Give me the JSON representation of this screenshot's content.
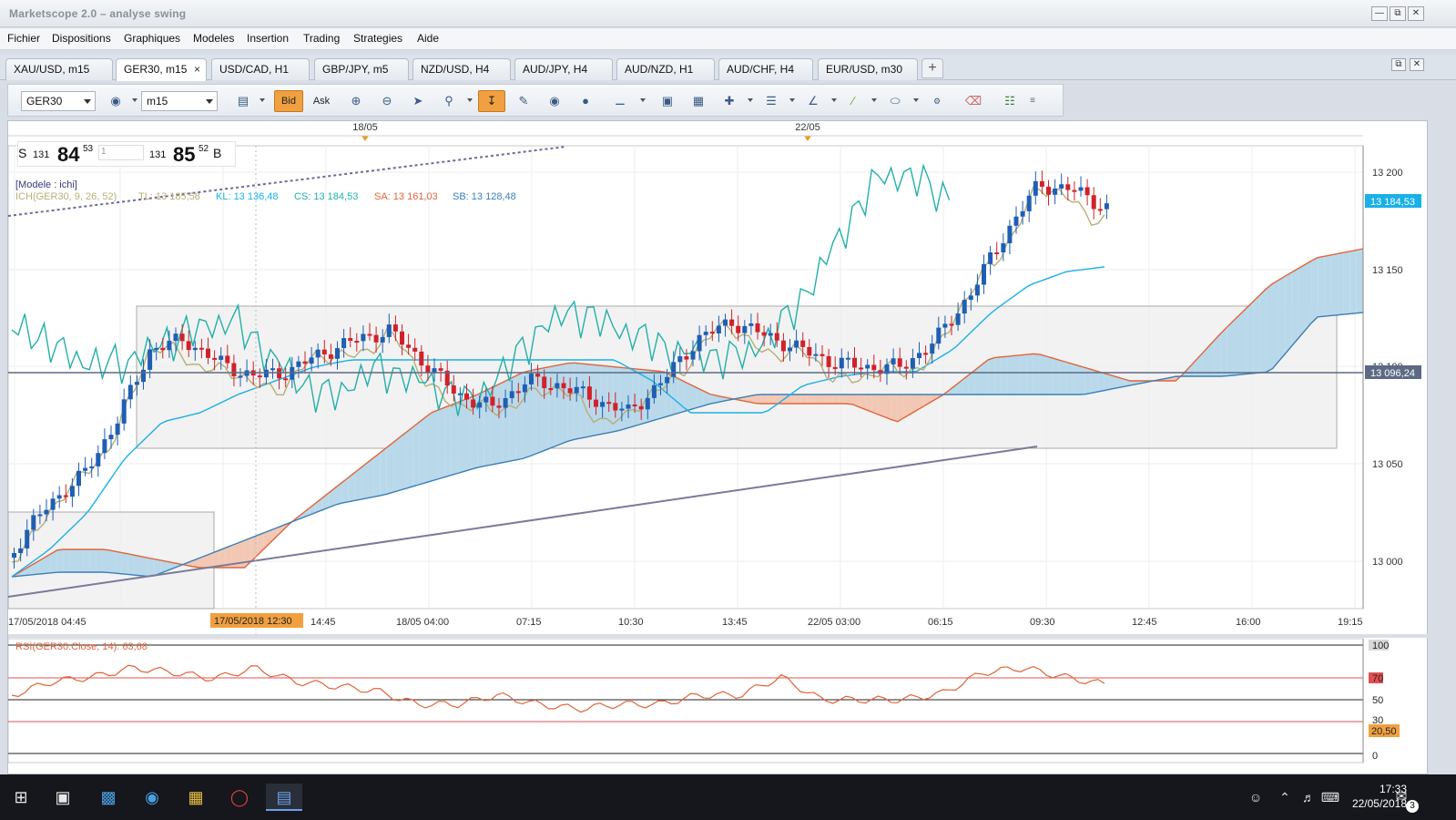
{
  "window": {
    "title": "Marketscope 2.0 – analyse swing",
    "buttons": {
      "minimize": "—",
      "restore": "⧉",
      "close": "✕"
    }
  },
  "menu": [
    "Fichier",
    "Dispositions",
    "Graphiques",
    "Modeles",
    "Insertion",
    "Trading",
    "Strategies",
    "Aide"
  ],
  "tabs": [
    {
      "label": "XAU/USD, m15",
      "active": false
    },
    {
      "label": "GER30, m15",
      "active": true
    },
    {
      "label": "USD/CAD, H1",
      "active": false
    },
    {
      "label": "GBP/JPY, m5",
      "active": false
    },
    {
      "label": "NZD/USD, H4",
      "active": false
    },
    {
      "label": "AUD/JPY, H4",
      "active": false
    },
    {
      "label": "AUD/NZD, H1",
      "active": false
    },
    {
      "label": "AUD/CHF, H4",
      "active": false
    },
    {
      "label": "EUR/USD, m30",
      "active": false
    }
  ],
  "tab_close": "×",
  "tab_add": "+",
  "toolbar": {
    "instrument": "GER30",
    "timeframe": "m15",
    "bid_label": "Bid",
    "ask_label": "Ask"
  },
  "quote": {
    "sell_label": "S",
    "sell_big": "131",
    "sell_main": "84",
    "sell_sup": "53",
    "amount": "1",
    "buy_big": "131",
    "buy_main": "85",
    "buy_sup": "52",
    "buy_label": "B"
  },
  "legend": {
    "model": "[Modele : ichi]",
    "ich": "ICH(GER30, 9, 26, 52)",
    "tl": "TL: 13 185,58",
    "kl": "KL: 13 136,48",
    "cs": "CS: 13 184,53",
    "sa": "SA: 13 161,03",
    "sb": "SB: 13 128,48"
  },
  "price_axis": {
    "ticks": [
      "13 200",
      "13 150",
      "13 100",
      "13 050",
      "13 000"
    ],
    "current_price": "13 184,53",
    "line_price": "13 096,24"
  },
  "top_markers": [
    "18/05",
    "22/05"
  ],
  "time_axis": {
    "labels": [
      "17/05/2018 04:45",
      "14:45",
      "18/05 04:00",
      "07:15",
      "10:30",
      "13:45",
      "22/05 03:00",
      "06:15",
      "09:30",
      "12:45",
      "16:00",
      "19:15"
    ],
    "cursor_label": "17/05/2018 12:30"
  },
  "rsi": {
    "label": "RSI(GER30.Close, 14): 63,68",
    "levels": [
      "100",
      "70",
      "50",
      "30",
      "0"
    ],
    "marker": "20,50"
  },
  "colors": {
    "bull": "#1e5fb4",
    "bear": "#d0222a",
    "tenkan": "#b8ae76",
    "kijun": "#1ab0e8",
    "chikou": "#22b0a8",
    "senkou_a": "#e0653a",
    "senkou_b": "#3a7fb8",
    "cloud_bull": "#b9d9ea",
    "cloud_bear": "#f2c8b5",
    "accent": "#f0a040"
  },
  "taskbar": {
    "time": "17:33",
    "date": "22/05/2018",
    "notifications": "3"
  }
}
